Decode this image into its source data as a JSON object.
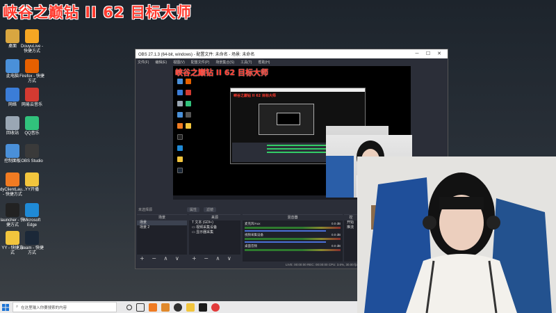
{
  "overlay_title": "峡谷之巅钻 II 62  目标大师",
  "desktop_icons": [
    {
      "label": "桌面",
      "icon": "folder-icon",
      "color": "#d9a640"
    },
    {
      "label": "DouyuLive - 快捷方式",
      "icon": "douyu-icon",
      "color": "#f5a623"
    },
    {
      "label": "此电脑",
      "icon": "computer-icon",
      "color": "#4a90d9"
    },
    {
      "label": "Firefox - 快捷方式",
      "icon": "firefox-icon",
      "color": "#e66000"
    },
    {
      "label": "网络",
      "icon": "network-icon",
      "color": "#3b7dd8"
    },
    {
      "label": "网易云音乐",
      "icon": "netease-music-icon",
      "color": "#d33a31"
    },
    {
      "label": "回收站",
      "icon": "recycle-bin-icon",
      "color": "#9aa7b4"
    },
    {
      "label": "QQ音乐",
      "icon": "qq-music-icon",
      "color": "#31c27c"
    },
    {
      "label": "控制面板",
      "icon": "control-panel-icon",
      "color": "#4a90d9"
    },
    {
      "label": "OBS Studio",
      "icon": "obs-icon",
      "color": "#3a3a3a"
    },
    {
      "label": "dyClientLau... - 快捷方式",
      "icon": "dyclient-icon",
      "color": "#f07b22"
    },
    {
      "label": "YY开播",
      "icon": "yy-live-icon",
      "color": "#f2c53d"
    },
    {
      "label": "launcher - 快捷方式",
      "icon": "launcher-icon",
      "color": "#222222"
    },
    {
      "label": "Microsoft Edge",
      "icon": "edge-icon",
      "color": "#1f8ad6"
    },
    {
      "label": "YY - 快捷方式",
      "icon": "yy-icon",
      "color": "#f2c53d"
    },
    {
      "label": "steam - 快捷方式",
      "icon": "steam-icon",
      "color": "#1b2838"
    }
  ],
  "obs": {
    "title": "OBS 27.1.3 (64-bit, windows) - 配置文件: 未命名 - 场景: 未命名",
    "window_buttons": [
      "─",
      "☐",
      "✕"
    ],
    "menu": [
      "文件(F)",
      "编辑(E)",
      "视图(V)",
      "配置文件(P)",
      "场景集合(S)",
      "工具(T)",
      "帮助(H)"
    ],
    "preview_title": "峡谷之巅钻 II 62  目标大师",
    "nested_title": "峡谷之巅钻 II 62  目标大师",
    "controls_label": "未选择源",
    "ctrl_buttons": [
      "属性",
      "滤镜"
    ],
    "scenes_header": "场景",
    "scenes": [
      "场景",
      "场景 2"
    ],
    "sources_header": "来源",
    "sources": [
      "文本 (GDI+)",
      "视频采集设备",
      "显示器采集"
    ],
    "mixer_header": "混音器",
    "mixer_channels": [
      {
        "name": "麦克风/Aux",
        "db": "0.0 dB"
      },
      {
        "name": "视频采集设备",
        "db": "0.0 dB"
      },
      {
        "name": "桌面音频",
        "db": "0.0 dB"
      }
    ],
    "controls_header": "控",
    "controls_items": [
      "开始",
      "推流"
    ],
    "dock_foot_symbols": "+ − ∧ ∨",
    "status": "LIVE: 00:00:00   REC: 00:00:00   CPU: 3.6%, 30.00 fps"
  },
  "taskbar": {
    "search_placeholder": "在这里输入你要搜索的内容"
  },
  "colors": {
    "accent_red": "#ff3a2e",
    "obs_bg": "#2b2e38"
  }
}
